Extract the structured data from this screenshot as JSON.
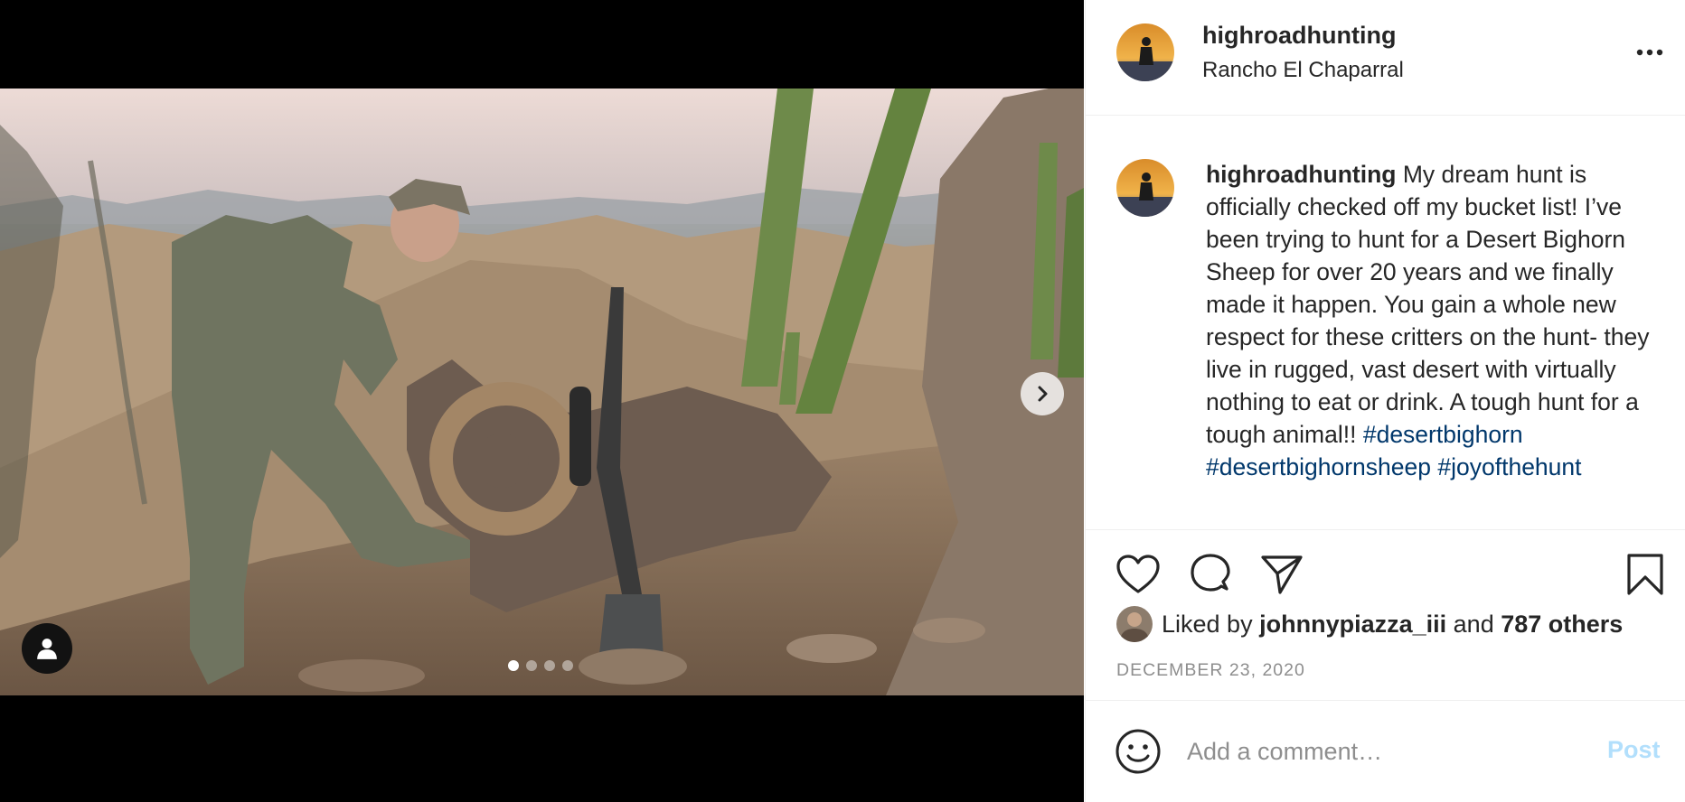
{
  "post": {
    "username": "highroadhunting",
    "location": "Rancho El Chaparral",
    "caption": {
      "username": "highroadhunting",
      "text": "My dream hunt is officially checked off my bucket list! I’ve been trying to hunt for a Desert Bighorn Sheep for over 20 years and we finally made it happen. You gain a whole new respect for these critters on the hunt- they live in rugged, vast desert with virtually nothing to eat or drink. A tough hunt for a tough animal!!",
      "hashtags": [
        "#desertbighorn",
        "#desertbighornsheep",
        "#joyofthehunt"
      ]
    },
    "likes": {
      "prefix": "Liked by",
      "user": "johnnypiazza_iii",
      "joiner": "and",
      "others": "787 others"
    },
    "date": "DECEMBER 23, 2020"
  },
  "carousel": {
    "total": 4,
    "active": 1
  },
  "comment_box": {
    "placeholder": "Add a comment…",
    "post_label": "Post"
  },
  "icons": {
    "more": "more-options-icon",
    "like": "heart-icon",
    "comment": "comment-bubble-icon",
    "share": "paper-plane-icon",
    "save": "bookmark-icon",
    "emoji": "emoji-smile-icon",
    "next": "chevron-right-icon",
    "user_tag": "person-icon"
  },
  "colors": {
    "hashtag": "#00376b",
    "post_button_disabled": "#b2dffc",
    "secondary_text": "#8e8e8e"
  }
}
